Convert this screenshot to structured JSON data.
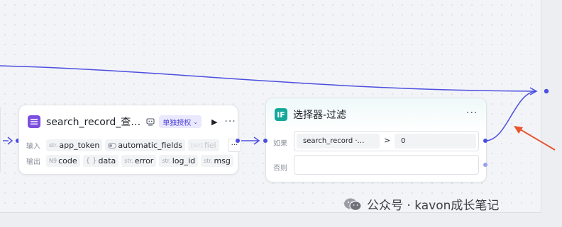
{
  "colors": {
    "accent": "#4c4ee0",
    "arrow": "#e8552f",
    "node1_icon": "#7b4ee0",
    "node2_icon": "#14a89a"
  },
  "node1": {
    "icon": "list-icon",
    "title": "search_record_查…",
    "auth_label": "单独授权",
    "input_label": "输入",
    "output_label": "输出",
    "inputs": [
      {
        "type": "str.",
        "name": "app_token"
      },
      {
        "type": "toggle",
        "name": "automatic_fields"
      },
      {
        "type": "[str]",
        "name": "fiel"
      }
    ],
    "outputs": [
      {
        "type": "N9",
        "name": "code"
      },
      {
        "type": "{ }",
        "name": "data"
      },
      {
        "type": "str.",
        "name": "error"
      },
      {
        "type": "str.",
        "name": "log_id"
      },
      {
        "type": "str.",
        "name": "msg"
      }
    ]
  },
  "node2": {
    "icon_text": "IF",
    "title": "选择器-过滤",
    "if_label": "如果",
    "else_label": "否则",
    "condition": {
      "left": "search_record ·…",
      "operator": ">",
      "right": "0"
    }
  },
  "watermark": {
    "text": "公众号 · kavon成长笔记"
  }
}
